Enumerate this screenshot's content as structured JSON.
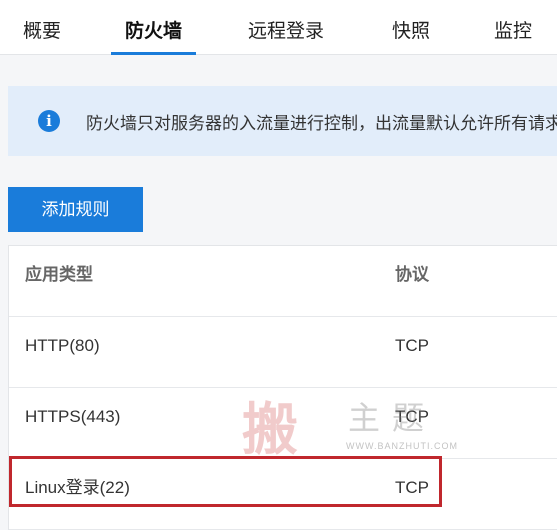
{
  "tabs": [
    {
      "label": "概要"
    },
    {
      "label": "防火墙",
      "active": true
    },
    {
      "label": "远程登录"
    },
    {
      "label": "快照"
    },
    {
      "label": "监控"
    }
  ],
  "notice": {
    "icon": "info-circle-icon",
    "text": "防火墙只对服务器的入流量进行控制，出流量默认允许所有请求"
  },
  "actions": {
    "add_rule_label": "添加规则"
  },
  "table": {
    "headers": [
      "应用类型",
      "协议"
    ],
    "rows": [
      {
        "app": "HTTP(80)",
        "protocol": "TCP"
      },
      {
        "app": "HTTPS(443)",
        "protocol": "TCP"
      },
      {
        "app": "Linux登录(22)",
        "protocol": "TCP"
      }
    ]
  },
  "watermark": {
    "main": "搬",
    "side": "主题",
    "url": "WWW.BANZHUTI.COM"
  },
  "colors": {
    "accent": "#1a7cda",
    "notice_bg": "#e2edfa",
    "highlight": "#c0272d"
  }
}
